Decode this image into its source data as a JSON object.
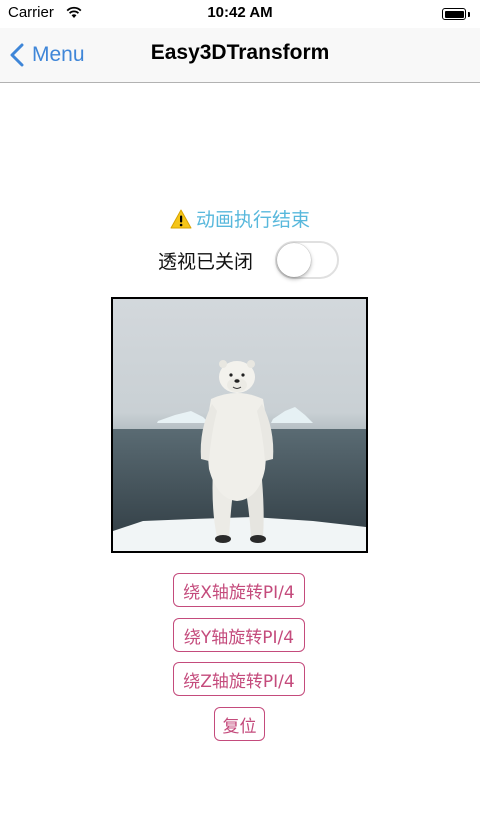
{
  "status_bar": {
    "carrier": "Carrier",
    "time": "10:42 AM"
  },
  "nav": {
    "back_label": "Menu",
    "title": "Easy3DTransform"
  },
  "animation_status": "动画执行结束",
  "perspective": {
    "label": "透视已关闭",
    "enabled": false
  },
  "buttons": {
    "rotate_x": "绕X轴旋转PI/4",
    "rotate_y": "绕Y轴旋转PI/4",
    "rotate_z": "绕Z轴旋转PI/4",
    "reset": "复位"
  },
  "colors": {
    "accent_blue": "#3f86d8",
    "status_text": "#58b8dc",
    "button_pink": "#c44b7c",
    "warning_yellow": "#f5c518"
  },
  "icons": [
    "wifi-icon",
    "battery-icon",
    "chevron-left-icon",
    "warning-icon"
  ]
}
